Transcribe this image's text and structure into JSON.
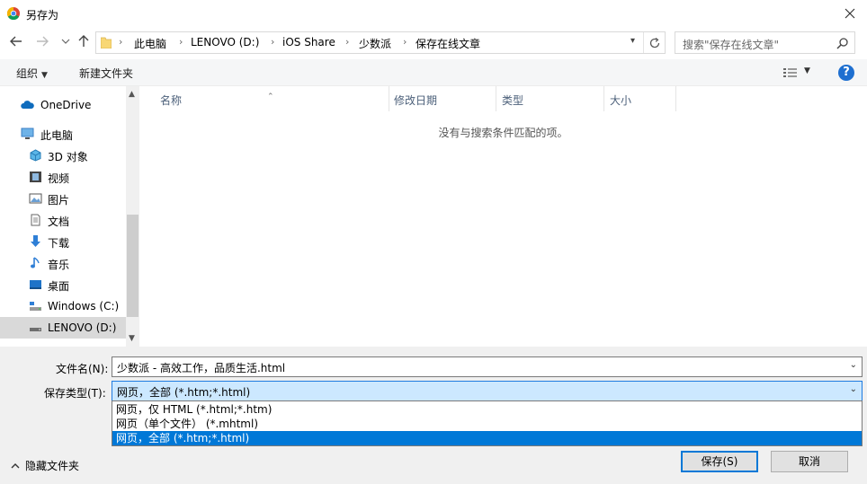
{
  "window": {
    "title": "另存为"
  },
  "nav": {
    "back_icon": "arrow-left-icon",
    "forward_icon": "arrow-right-icon",
    "recent_icon": "chevron-down-icon",
    "up_icon": "arrow-up-icon"
  },
  "address": {
    "breadcrumbs": [
      "此电脑",
      "LENOVO (D:)",
      "iOS Share",
      "少数派",
      "保存在线文章"
    ]
  },
  "search": {
    "placeholder": "搜索\"保存在线文章\""
  },
  "toolbar": {
    "organize_label": "组织",
    "new_folder_label": "新建文件夹",
    "help_label": "?"
  },
  "sidebar": {
    "items": [
      {
        "label": "OneDrive",
        "icon": "cloud-icon"
      },
      {
        "label": "此电脑",
        "icon": "computer-icon"
      },
      {
        "label": "3D 对象",
        "icon": "cube-icon"
      },
      {
        "label": "视频",
        "icon": "video-icon"
      },
      {
        "label": "图片",
        "icon": "picture-icon"
      },
      {
        "label": "文档",
        "icon": "document-icon"
      },
      {
        "label": "下载",
        "icon": "download-icon"
      },
      {
        "label": "音乐",
        "icon": "music-icon"
      },
      {
        "label": "桌面",
        "icon": "desktop-icon"
      },
      {
        "label": "Windows (C:)",
        "icon": "drive-c-icon"
      },
      {
        "label": "LENOVO (D:)",
        "icon": "drive-d-icon"
      }
    ]
  },
  "columns": {
    "name": "名称",
    "modified": "修改日期",
    "type": "类型",
    "size": "大小"
  },
  "empty_message": "没有与搜索条件匹配的项。",
  "form": {
    "filename_label": "文件名(N):",
    "filename_value": "少数派 - 高效工作，品质生活.html",
    "filetype_label": "保存类型(T):",
    "filetype_value": "网页，全部 (*.htm;*.html)",
    "filetype_options": [
      "网页，仅 HTML (*.html;*.htm)",
      "网页（单个文件） (*.mhtml)",
      "网页，全部 (*.htm;*.html)"
    ]
  },
  "footer": {
    "hide_folders_label": "隐藏文件夹",
    "save_label": "保存(S)",
    "cancel_label": "取消"
  }
}
